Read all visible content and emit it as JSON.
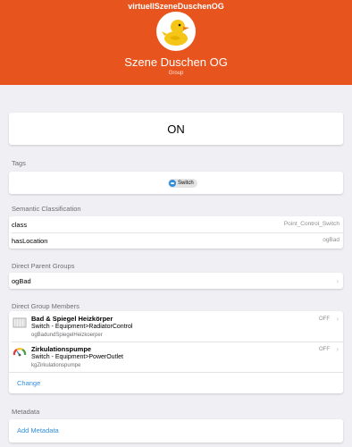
{
  "header": {
    "top_title": "virtuellSzeneDuschenOG",
    "label": "Szene Duschen OG",
    "type": "Group",
    "avatar_icon": "duck-icon",
    "bg_color": "#e8541e"
  },
  "state": {
    "value": "ON"
  },
  "tags": {
    "title": "Tags",
    "items": [
      {
        "label": "Switch",
        "icon": "switch-icon"
      }
    ]
  },
  "semantic": {
    "title": "Semantic Classification",
    "rows": [
      {
        "key": "class",
        "value": "Point_Control_Switch"
      },
      {
        "key": "hasLocation",
        "value": "ogBad"
      }
    ]
  },
  "parents": {
    "title": "Direct Parent Groups",
    "items": [
      {
        "label": "ogBad"
      }
    ]
  },
  "members": {
    "title": "Direct Group Members",
    "items": [
      {
        "label": "Bad & Spiegel Heizkörper",
        "semantic": "Switch - Equipment>RadiatorControl",
        "name": "ogBadundSpiegelHeizkoerper",
        "state": "OFF",
        "icon": "radiator-icon"
      },
      {
        "label": "Zirkulationspumpe",
        "semantic": "Switch - Equipment>PowerOutlet",
        "name": "kgZirkulationspumpe",
        "state": "OFF",
        "icon": "gauge-icon"
      }
    ],
    "change_label": "Change"
  },
  "metadata": {
    "title": "Metadata",
    "add_label": "Add Metadata"
  },
  "colors": {
    "accent": "#2f8fde",
    "header": "#e8541e",
    "background": "#efeff4"
  }
}
